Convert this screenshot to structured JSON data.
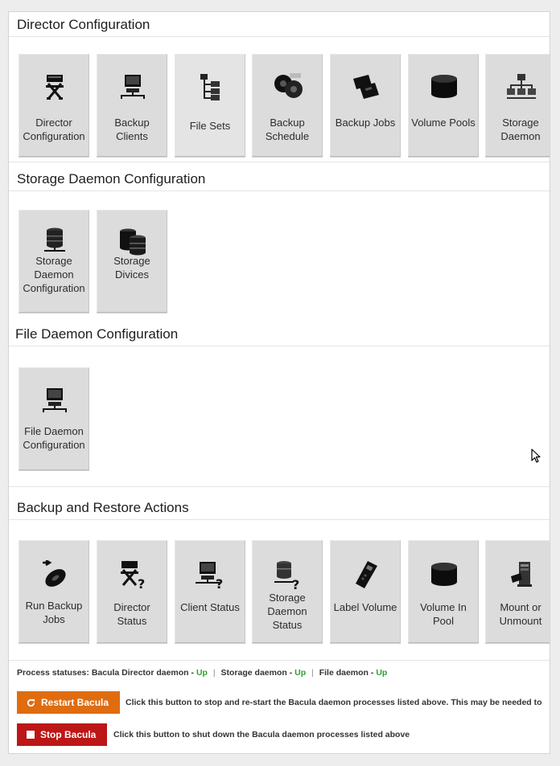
{
  "sections": {
    "director": {
      "title": "Director Configuration",
      "tiles": [
        {
          "label": "Director Configuration",
          "icon": "directors-chair-icon"
        },
        {
          "label": "Backup Clients",
          "icon": "computer-network-icon"
        },
        {
          "label": "File Sets",
          "icon": "file-tree-icon"
        },
        {
          "label": "Backup Schedule",
          "icon": "schedule-reels-icon"
        },
        {
          "label": "Backup Jobs",
          "icon": "tape-cartridges-icon"
        },
        {
          "label": "Volume Pools",
          "icon": "disk-cylinder-icon"
        },
        {
          "label": "Storage Daemon",
          "icon": "network-hierarchy-icon"
        }
      ]
    },
    "storage": {
      "title": "Storage Daemon Configuration",
      "tiles": [
        {
          "label": "Storage Daemon Configuration",
          "icon": "database-server-icon"
        },
        {
          "label": "Storage Divices",
          "icon": "database-stack-icon"
        }
      ]
    },
    "file": {
      "title": "File Daemon Configuration",
      "tiles": [
        {
          "label": "File Daemon Configuration",
          "icon": "computer-network-icon"
        }
      ]
    },
    "actions": {
      "title": "Backup and Restore Actions",
      "tiles": [
        {
          "label": "Run Backup Jobs",
          "icon": "run-tape-icon"
        },
        {
          "label": "Director Status",
          "icon": "directors-chair-question-icon"
        },
        {
          "label": "Client Status",
          "icon": "computer-question-icon"
        },
        {
          "label": "Storage Daemon Status",
          "icon": "database-question-icon"
        },
        {
          "label": "Label Volume",
          "icon": "barcode-scanner-icon"
        },
        {
          "label": "Volume In Pool",
          "icon": "disk-cylinder-icon"
        },
        {
          "label": "Mount or Unmount",
          "icon": "tape-drive-icon"
        }
      ]
    }
  },
  "status": {
    "prefix": "Process statuses:",
    "director_label": "Bacula Director daemon -",
    "director_value": "Up",
    "separator": "|",
    "storage_label": "Storage daemon -",
    "storage_value": "Up",
    "file_label": "File daemon -",
    "file_value": "Up"
  },
  "buttons": {
    "restart_label": "Restart Bacula",
    "restart_desc": "Click this button to stop and re-start the Bacula daemon processes listed above. This may be needed to",
    "stop_label": "Stop Bacula",
    "stop_desc": "Click this button to shut down the Bacula daemon processes listed above"
  },
  "colors": {
    "restart": "#e06c10",
    "stop": "#bd1616",
    "up": "#2ea12e",
    "tile": "#dcdcdc"
  }
}
